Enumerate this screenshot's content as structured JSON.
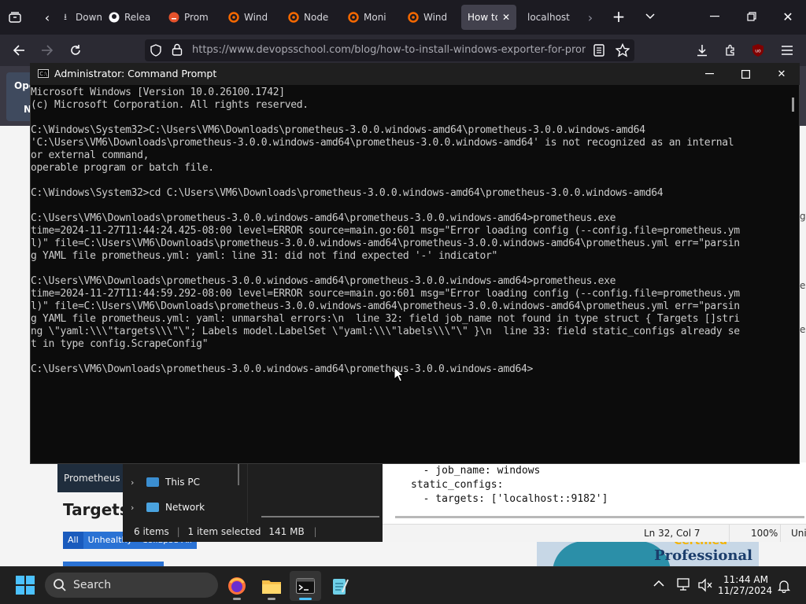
{
  "browser": {
    "tabs": [
      {
        "label": "Down",
        "icon": "download-icon"
      },
      {
        "label": "Relea",
        "icon": "github-icon"
      },
      {
        "label": "Prom",
        "icon": "prometheus-icon"
      },
      {
        "label": "Wind",
        "icon": "grafana-icon"
      },
      {
        "label": "Node",
        "icon": "grafana-icon"
      },
      {
        "label": "Moni",
        "icon": "grafana-icon"
      },
      {
        "label": "Wind",
        "icon": "grafana-icon"
      },
      {
        "label": "How to",
        "icon": "none",
        "active": true
      },
      {
        "label": "localhost",
        "icon": "none"
      }
    ],
    "url": "https://www.devopsschool.com/blog/how-to-install-windows-exporter-for-prome",
    "profile_badge": "uo"
  },
  "background_page": {
    "ope_button": "Ope",
    "ope_button_sub": "N",
    "prometheus_nav": "Prometheus",
    "targets_heading": "Targets",
    "filter_buttons": [
      "All",
      "Unhealthy",
      "Collapse All"
    ],
    "ad_text": "Professional",
    "ad_text2": "Certified"
  },
  "explorer": {
    "tree": [
      {
        "label": "This PC",
        "icon": "this-pc-icon"
      },
      {
        "label": "Network",
        "icon": "network-icon"
      }
    ],
    "status": {
      "items": "6 items",
      "selected": "1 item selected",
      "size": "141 MB"
    }
  },
  "notepad": {
    "lines": [
      "  - job_name: windows",
      "static_configs:",
      "  - targets: ['localhost::9182']"
    ],
    "status": {
      "position": "Ln 32, Col 7",
      "zoom": "100%",
      "encoding": "Uni"
    }
  },
  "cmd": {
    "title": "Administrator: Command Prompt",
    "icon_text": "C:\\",
    "lines": [
      "Microsoft Windows [Version 10.0.26100.1742]",
      "(c) Microsoft Corporation. All rights reserved.",
      "",
      "C:\\Windows\\System32>C:\\Users\\VM6\\Downloads\\prometheus-3.0.0.windows-amd64\\prometheus-3.0.0.windows-amd64",
      "'C:\\Users\\VM6\\Downloads\\prometheus-3.0.0.windows-amd64\\prometheus-3.0.0.windows-amd64' is not recognized as an internal",
      "or external command,",
      "operable program or batch file.",
      "",
      "C:\\Windows\\System32>cd C:\\Users\\VM6\\Downloads\\prometheus-3.0.0.windows-amd64\\prometheus-3.0.0.windows-amd64",
      "",
      "C:\\Users\\VM6\\Downloads\\prometheus-3.0.0.windows-amd64\\prometheus-3.0.0.windows-amd64>prometheus.exe",
      "time=2024-11-27T11:44:24.425-08:00 level=ERROR source=main.go:601 msg=\"Error loading config (--config.file=prometheus.ym",
      "l)\" file=C:\\Users\\VM6\\Downloads\\prometheus-3.0.0.windows-amd64\\prometheus-3.0.0.windows-amd64\\prometheus.yml err=\"parsin",
      "g YAML file prometheus.yml: yaml: line 31: did not find expected '-' indicator\"",
      "",
      "C:\\Users\\VM6\\Downloads\\prometheus-3.0.0.windows-amd64\\prometheus-3.0.0.windows-amd64>prometheus.exe",
      "time=2024-11-27T11:44:59.292-08:00 level=ERROR source=main.go:601 msg=\"Error loading config (--config.file=prometheus.ym",
      "l)\" file=C:\\Users\\VM6\\Downloads\\prometheus-3.0.0.windows-amd64\\prometheus-3.0.0.windows-amd64\\prometheus.yml err=\"parsin",
      "g YAML file prometheus.yml: yaml: unmarshal errors:\\n  line 32: field job_name not found in type struct { Targets []stri",
      "ng \\\"yaml:\\\\\\\"targets\\\\\\\"\\\"; Labels model.LabelSet \\\"yaml:\\\\\\\"labels\\\\\\\"\\\" }\\n  line 33: field static_configs already se",
      "t in type config.ScrapeConfig\"",
      "",
      "C:\\Users\\VM6\\Downloads\\prometheus-3.0.0.windows-amd64\\prometheus-3.0.0.windows-amd64>"
    ]
  },
  "taskbar": {
    "search_label": "Search",
    "time": "11:44 AM",
    "date": "11/27/2024"
  }
}
